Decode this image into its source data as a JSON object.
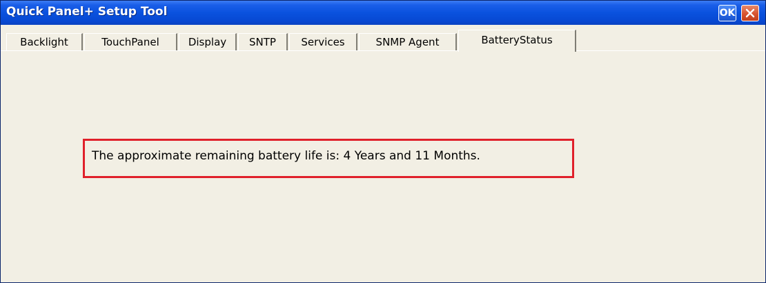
{
  "window": {
    "title": "Quick Panel+ Setup Tool",
    "ok_label": "OK",
    "close_icon": "close-icon",
    "colors": {
      "titlebar": "#0a52de",
      "content_background": "#f2efe4",
      "highlight": "#e0202a",
      "close_button": "#d8542f"
    }
  },
  "tabs": [
    {
      "label": "Backlight",
      "active": false
    },
    {
      "label": "TouchPanel",
      "active": false
    },
    {
      "label": "Display",
      "active": false
    },
    {
      "label": "SNTP",
      "active": false
    },
    {
      "label": "Services",
      "active": false
    },
    {
      "label": "SNMP Agent",
      "active": false
    },
    {
      "label": "BatteryStatus",
      "active": true
    }
  ],
  "battery": {
    "status_text": "The approximate remaining battery life is: 4 Years and 11 Months."
  }
}
